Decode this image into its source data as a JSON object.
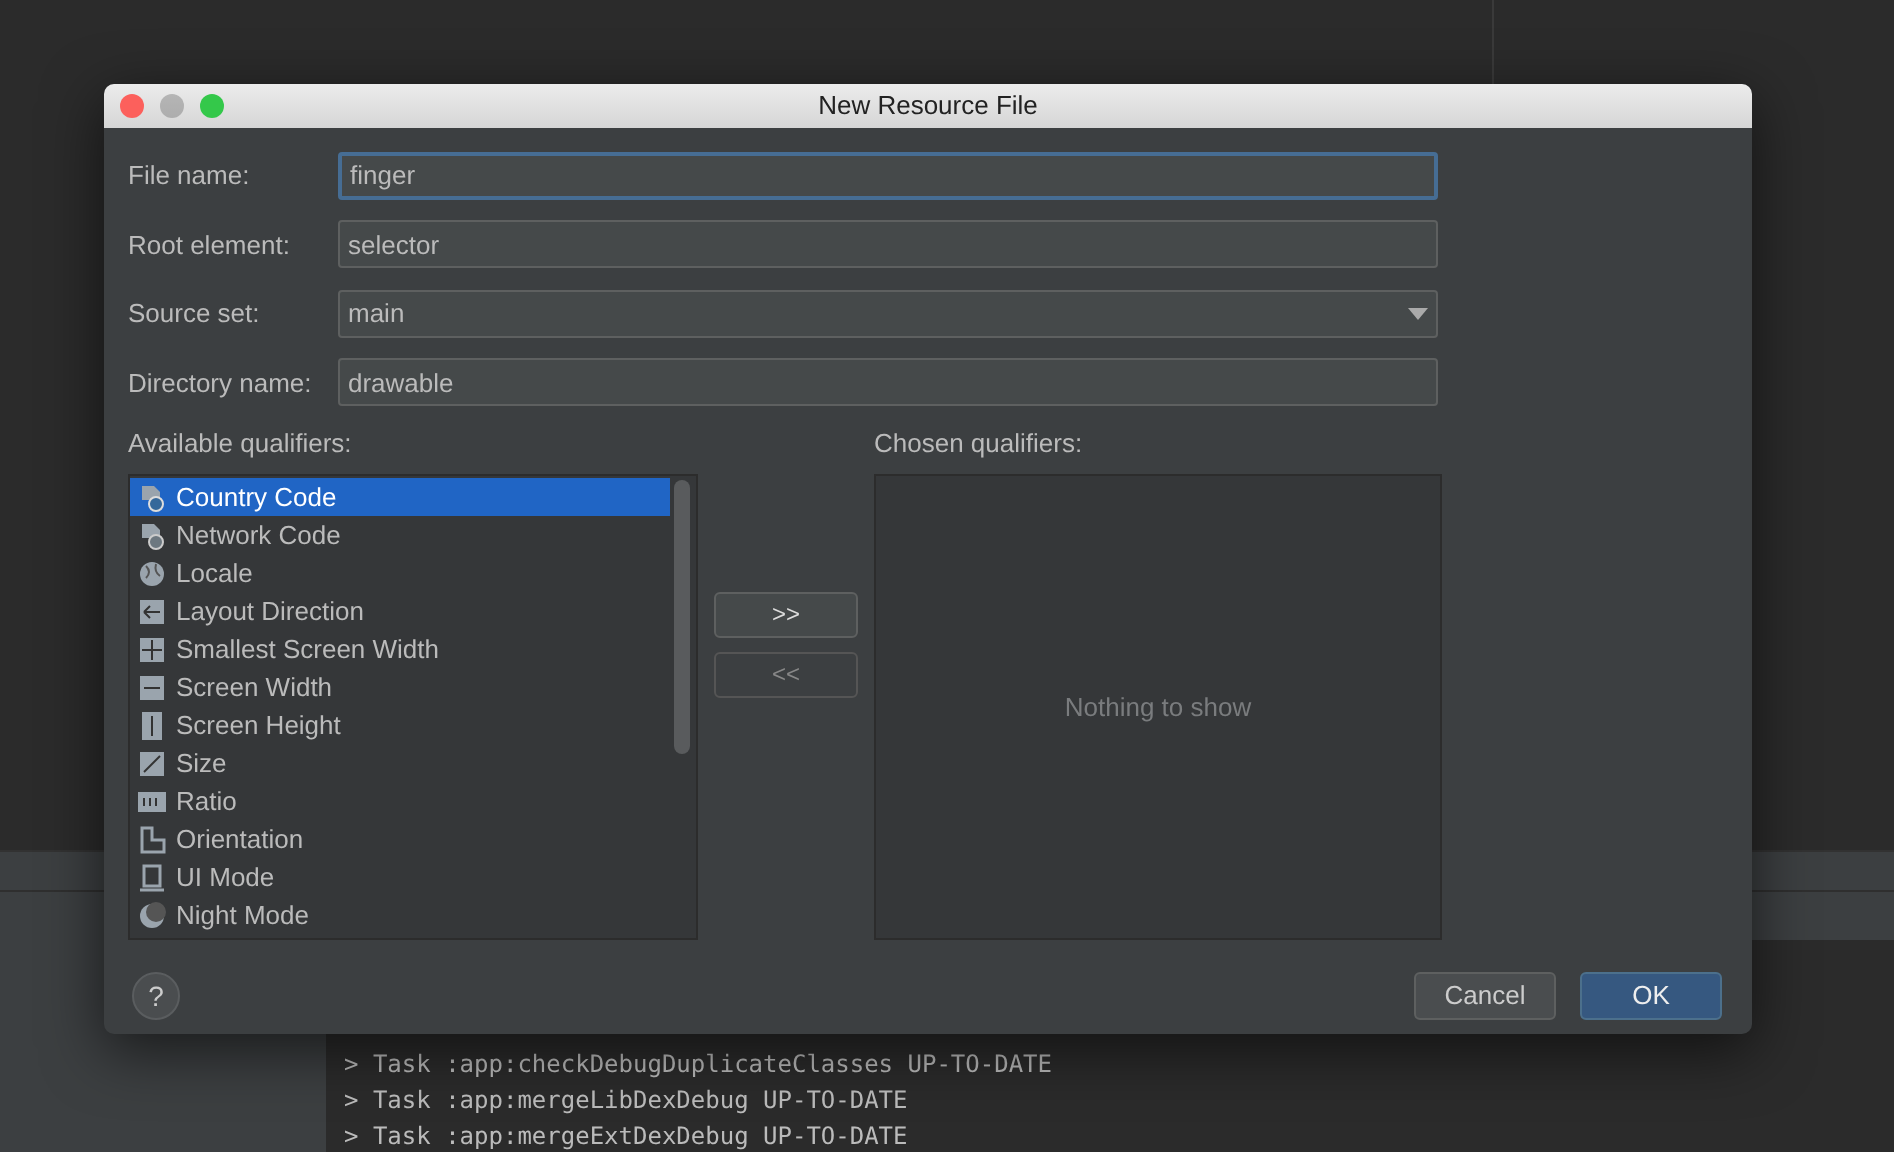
{
  "window": {
    "title": "New Resource File"
  },
  "fields": [
    {
      "label": "File name:",
      "value": "finger",
      "kind": "text",
      "focused": true
    },
    {
      "label": "Root element:",
      "value": "selector",
      "kind": "text",
      "focused": false
    },
    {
      "label": "Source set:",
      "value": "main",
      "kind": "dropdown",
      "focused": false
    },
    {
      "label": "Directory name:",
      "value": "drawable",
      "kind": "text",
      "focused": false
    }
  ],
  "available_qualifiers": {
    "label": "Available qualifiers:",
    "items": [
      {
        "label": "Country Code",
        "selected": true
      },
      {
        "label": "Network Code",
        "selected": false
      },
      {
        "label": "Locale",
        "selected": false
      },
      {
        "label": "Layout Direction",
        "selected": false
      },
      {
        "label": "Smallest Screen Width",
        "selected": false
      },
      {
        "label": "Screen Width",
        "selected": false
      },
      {
        "label": "Screen Height",
        "selected": false
      },
      {
        "label": "Size",
        "selected": false
      },
      {
        "label": "Ratio",
        "selected": false
      },
      {
        "label": "Orientation",
        "selected": false
      },
      {
        "label": "UI Mode",
        "selected": false
      },
      {
        "label": "Night Mode",
        "selected": false
      }
    ]
  },
  "transfer_buttons": [
    {
      "label": ">>",
      "disabled": false
    },
    {
      "label": "<<",
      "disabled": true
    }
  ],
  "chosen_qualifiers": {
    "label": "Chosen qualifiers:",
    "empty_text": "Nothing to show"
  },
  "help_button": {
    "label": "?"
  },
  "buttons": [
    {
      "label": "Cancel",
      "kind": "secondary"
    },
    {
      "label": "OK",
      "kind": "primary"
    }
  ],
  "console": {
    "lines": [
      "> Task :app:checkDebugDuplicateClasses UP-TO-DATE",
      "> Task :app:mergeLibDexDebug UP-TO-DATE",
      "> Task :app:mergeExtDexDebug UP-TO-DATE"
    ]
  }
}
